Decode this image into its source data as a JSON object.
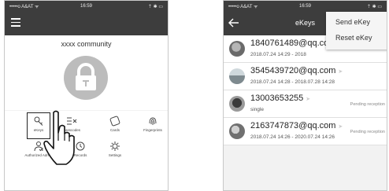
{
  "left_screen": {
    "status": {
      "carrier": "•••••o  A&AT  ᯤ",
      "time": "16:59",
      "right": "⇡ ✱ ▭"
    },
    "community_name": "xxxx community",
    "grid": [
      {
        "label": "eKeys",
        "icon": "key-icon"
      },
      {
        "label": "Passcodes",
        "icon": "passcode-icon"
      },
      {
        "label": "Cards",
        "icon": "card-icon"
      },
      {
        "label": "Fingerprints",
        "icon": "fingerprint-icon"
      },
      {
        "label": "Authorized Admin",
        "icon": "admin-icon"
      },
      {
        "label": "Records",
        "icon": "records-icon"
      },
      {
        "label": "Settings",
        "icon": "gear-icon"
      }
    ]
  },
  "right_screen": {
    "status": {
      "carrier": "•••••o  A&AT  ᯤ",
      "time": "16:59",
      "right": "⇡ ✱ ▭"
    },
    "title": "eKeys",
    "menu": {
      "send": "Send eKey",
      "reset": "Reset eKey"
    },
    "entries": [
      {
        "name": "1840761489@qq.com",
        "sub": "2018.07.24 14:29 - 2018",
        "status": ""
      },
      {
        "name": "3545439720@qq.com",
        "sub": "2018.07.24 14:28 - 2018.07.28 14:28",
        "status": ""
      },
      {
        "name": "13003653255",
        "sub": "single",
        "status": "Pending reception"
      },
      {
        "name": "2163747873@qq.com",
        "sub": "2018.07.24 14:26 - 2020.07.24 14:26",
        "status": "Pending reception"
      }
    ]
  }
}
